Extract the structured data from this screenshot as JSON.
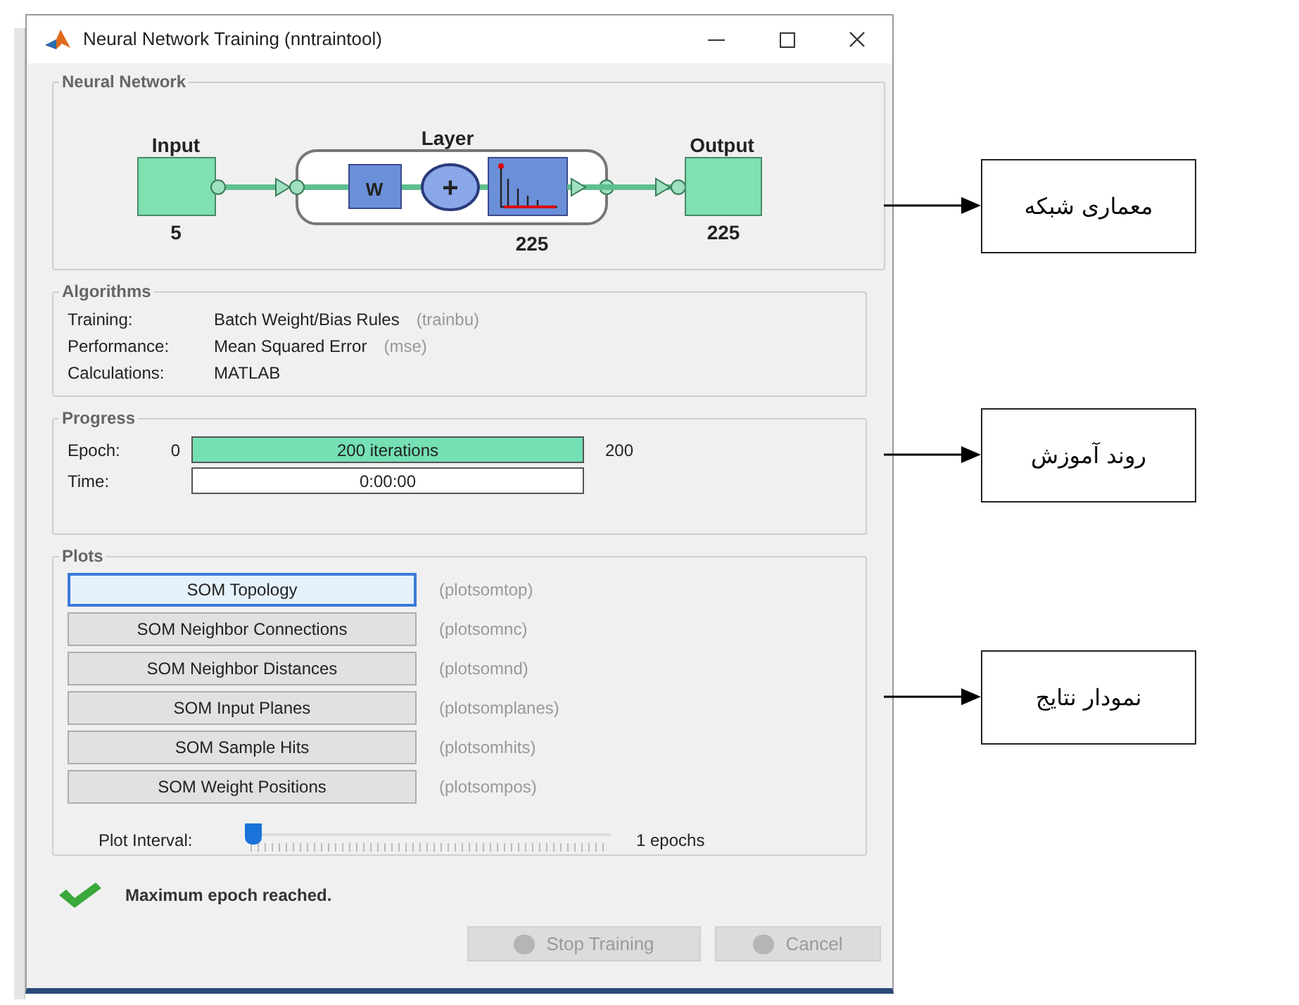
{
  "window": {
    "title": "Neural Network Training (nntraintool)"
  },
  "neural_network": {
    "title": "Neural Network",
    "input_label": "Input",
    "input_size": "5",
    "layer_label": "Layer",
    "weight_label": "W",
    "sum_symbol": "+",
    "layer_size": "225",
    "output_label": "Output",
    "output_size": "225"
  },
  "algorithms": {
    "title": "Algorithms",
    "rows": [
      {
        "label": "Training:",
        "value": "Batch Weight/Bias Rules",
        "code": "(trainbu)"
      },
      {
        "label": "Performance:",
        "value": "Mean Squared Error",
        "code": "(mse)"
      },
      {
        "label": "Calculations:",
        "value": "MATLAB"
      }
    ]
  },
  "progress": {
    "title": "Progress",
    "rows": [
      {
        "kind": "bar",
        "label": "Epoch:",
        "start": "0",
        "text": "200 iterations",
        "level": 1,
        "end": "200"
      },
      {
        "kind": "field",
        "label": "Time:",
        "text": "0:00:00"
      }
    ]
  },
  "plots": {
    "title": "Plots",
    "buttons": [
      {
        "label": "SOM Topology",
        "function": "(plotsomtop)",
        "focused": true
      },
      {
        "label": "SOM Neighbor Connections",
        "function": "(plotsomnc)",
        "focused": false
      },
      {
        "label": "SOM Neighbor Distances",
        "function": "(plotsomnd)",
        "focused": false
      },
      {
        "label": "SOM Input Planes",
        "function": "(plotsomplanes)",
        "focused": false
      },
      {
        "label": "SOM Sample Hits",
        "function": "(plotsomhits)",
        "focused": false
      },
      {
        "label": "SOM Weight Positions",
        "function": "(plotsompos)",
        "focused": false
      }
    ],
    "interval": {
      "label": "Plot Interval:",
      "level": 0,
      "value": "1 epochs"
    }
  },
  "status": {
    "message": "Maximum epoch reached."
  },
  "buttons": [
    {
      "label": "Stop Training",
      "disabled": true
    },
    {
      "label": "Cancel",
      "disabled": true
    }
  ],
  "annotations": [
    {
      "text": "معماری شبکه"
    },
    {
      "text": "روند آموزش"
    },
    {
      "text": "نمودار نتایج"
    }
  ]
}
